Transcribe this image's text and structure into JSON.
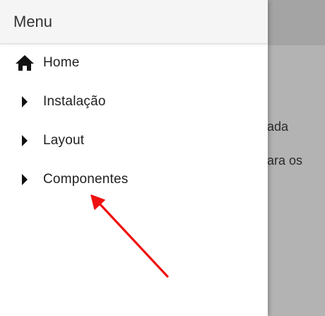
{
  "background": {
    "text_line1": "ada",
    "text_line2": "ara os"
  },
  "drawer": {
    "title": "Menu",
    "items": [
      {
        "label": "Home",
        "icon": "home-icon"
      },
      {
        "label": "Instalação",
        "icon": "caret-right-icon"
      },
      {
        "label": "Layout",
        "icon": "caret-right-icon"
      },
      {
        "label": "Componentes",
        "icon": "caret-right-icon"
      }
    ]
  },
  "colors": {
    "scrim": "#b3b3b3",
    "drawer_header": "#f5f5f5",
    "arrow": "#ee1111"
  }
}
